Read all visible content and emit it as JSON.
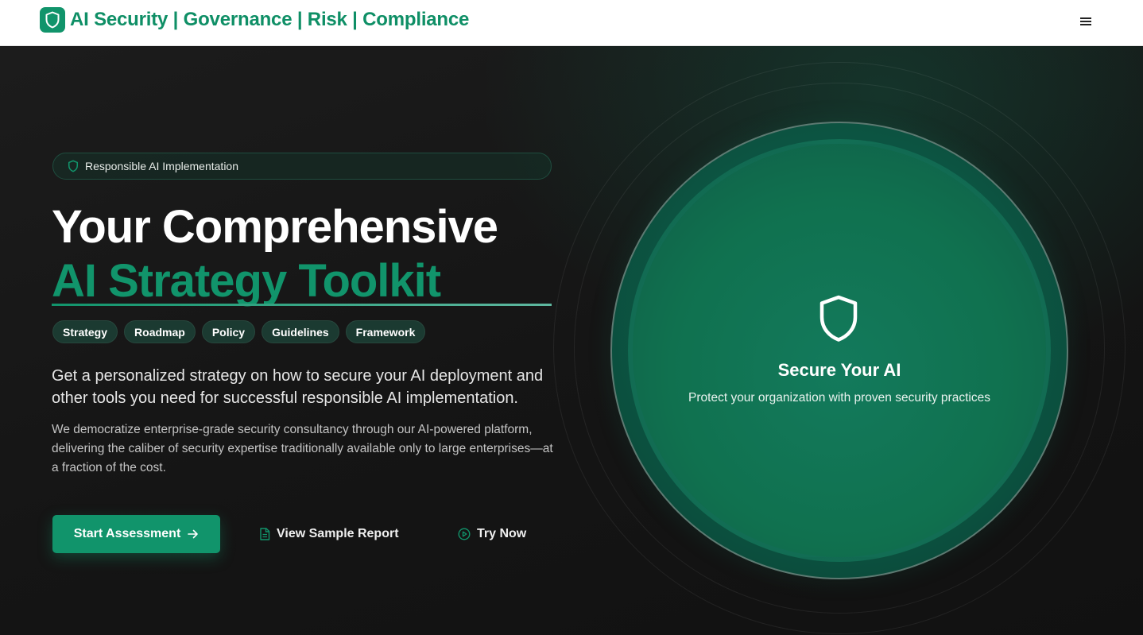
{
  "header": {
    "brand_icon": "shield-icon",
    "title": "AI Security | Governance | Risk | Compliance",
    "menu_icon": "hamburger-menu-icon"
  },
  "hero": {
    "badge": {
      "icon": "shield-icon",
      "label": "Responsible AI Implementation"
    },
    "headline": "Your Comprehensive",
    "headline_accent": "AI Strategy Toolkit",
    "tags": [
      "Strategy",
      "Roadmap",
      "Policy",
      "Guidelines",
      "Framework"
    ],
    "lead": "Get a personalized strategy on how to secure your AI deployment and other tools you need for successful responsible AI implementation.",
    "description": "We democratize enterprise-grade security consultancy through our AI-powered platform, delivering the caliber of security expertise traditionally available only to large enterprises—at a fraction of the cost.",
    "actions": {
      "primary": {
        "label": "Start Assessment",
        "icon": "arrow-right-icon"
      },
      "secondary": {
        "label": "View Sample Report",
        "icon": "document-icon"
      },
      "tertiary": {
        "label": "Try Now",
        "icon": "play-circle-icon"
      }
    }
  },
  "feature_card": {
    "icon": "shield-icon",
    "title": "Secure Your AI",
    "text": "Protect your organization with proven security practices"
  },
  "colors": {
    "accent": "#11946b",
    "background": "#151515",
    "header_bg": "#ffffff"
  }
}
